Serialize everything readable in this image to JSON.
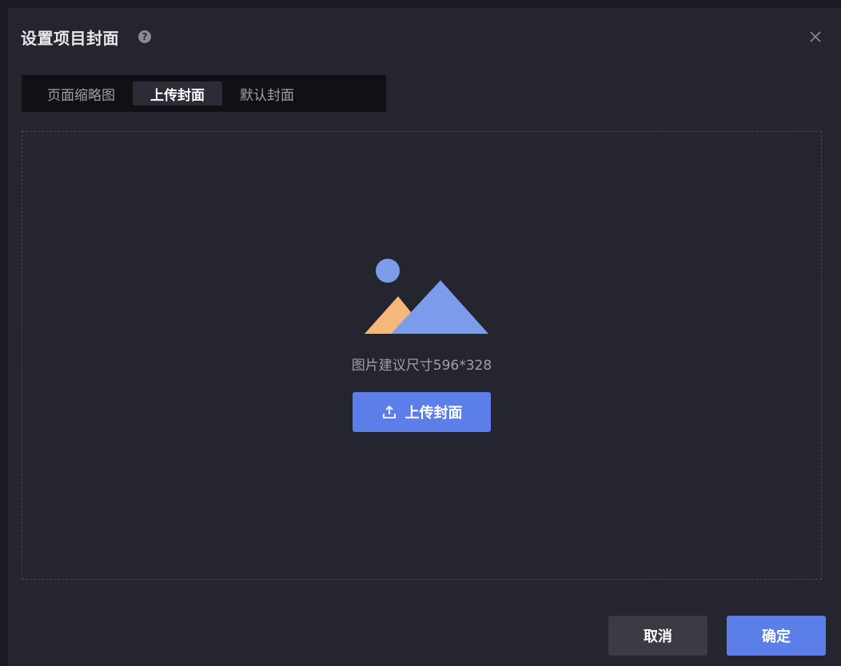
{
  "dialog": {
    "title": "设置项目封面",
    "help_icon": "question-circle-icon",
    "close_icon": "close-icon"
  },
  "tabs": [
    {
      "label": "页面缩略图",
      "active": false
    },
    {
      "label": "上传封面",
      "active": true
    },
    {
      "label": "默认封面",
      "active": false
    }
  ],
  "upload": {
    "illustration_icon": "image-placeholder-icon",
    "hint": "图片建议尺寸596*328",
    "button_label": "上传封面",
    "button_icon": "upload-icon"
  },
  "footer": {
    "cancel_label": "取消",
    "confirm_label": "确定"
  },
  "colors": {
    "accent": "#5c7ee8",
    "background": "#24252e",
    "tab_bar": "#101114",
    "mountain_orange": "#f5b77a",
    "mountain_blue": "#7c9bea"
  }
}
